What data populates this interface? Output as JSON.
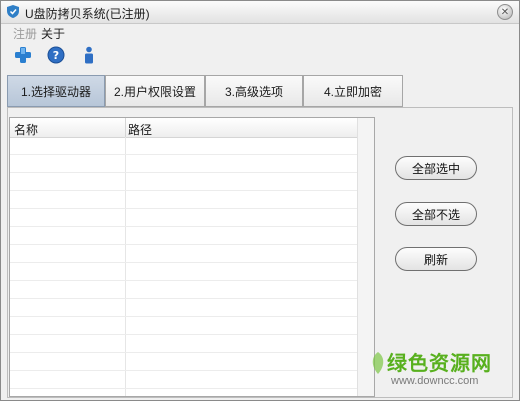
{
  "window": {
    "title": "U盘防拷贝系统(已注册)"
  },
  "menu": {
    "items": [
      {
        "label": "注册",
        "enabled": false
      },
      {
        "label": "关于",
        "enabled": true
      }
    ]
  },
  "toolbar": {
    "buttons": [
      {
        "icon": "add-icon"
      },
      {
        "icon": "help-icon"
      },
      {
        "icon": "info-icon"
      }
    ]
  },
  "tabs": [
    {
      "label": "1.选择驱动器",
      "active": true
    },
    {
      "label": "2.用户权限设置",
      "active": false
    },
    {
      "label": "3.高级选项",
      "active": false
    },
    {
      "label": "4.立即加密",
      "active": false
    }
  ],
  "drive_list": {
    "columns": [
      "名称",
      "路径"
    ],
    "rows": []
  },
  "actions": {
    "select_all": "全部选中",
    "select_none": "全部不选",
    "refresh": "刷新"
  },
  "watermark": {
    "text": "绿色资源网",
    "url": "www.downcc.com"
  },
  "colors": {
    "active_tab": "#bccadb",
    "watermark": "#58b01e"
  }
}
